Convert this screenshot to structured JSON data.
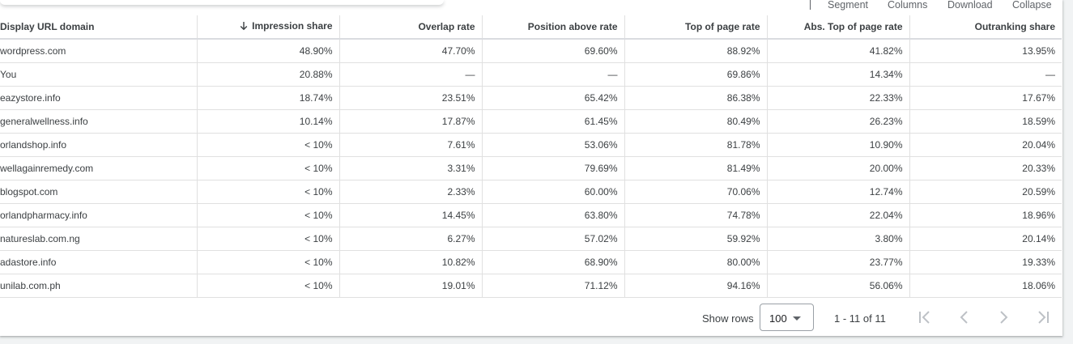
{
  "toolbar": {
    "segment_label": "Segment",
    "columns_label": "Columns",
    "download_label": "Download",
    "collapse_label": "Collapse"
  },
  "table": {
    "headers": [
      "Display URL domain",
      "Impression share",
      "Overlap rate",
      "Position above rate",
      "Top of page rate",
      "Abs. Top of page rate",
      "Outranking share"
    ],
    "sort_icon": "arrow-downward-icon",
    "rows": [
      [
        "wordpress.com",
        "48.90%",
        "47.70%",
        "69.60%",
        "88.92%",
        "41.82%",
        "13.95%"
      ],
      [
        "You",
        "20.88%",
        "—",
        "—",
        "69.86%",
        "14.34%",
        "—"
      ],
      [
        "eazystore.info",
        "18.74%",
        "23.51%",
        "65.42%",
        "86.38%",
        "22.33%",
        "17.67%"
      ],
      [
        "generalwellness.info",
        "10.14%",
        "17.87%",
        "61.45%",
        "80.49%",
        "26.23%",
        "18.59%"
      ],
      [
        "orlandshop.info",
        "< 10%",
        "7.61%",
        "53.06%",
        "81.78%",
        "10.90%",
        "20.04%"
      ],
      [
        "wellagainremedy.com",
        "< 10%",
        "3.31%",
        "79.69%",
        "81.49%",
        "20.00%",
        "20.33%"
      ],
      [
        "blogspot.com",
        "< 10%",
        "2.33%",
        "60.00%",
        "70.06%",
        "12.74%",
        "20.59%"
      ],
      [
        "orlandpharmacy.info",
        "< 10%",
        "14.45%",
        "63.80%",
        "74.78%",
        "22.04%",
        "18.96%"
      ],
      [
        "natureslab.com.ng",
        "< 10%",
        "6.27%",
        "57.02%",
        "59.92%",
        "3.80%",
        "20.14%"
      ],
      [
        "adastore.info",
        "< 10%",
        "10.82%",
        "68.90%",
        "80.00%",
        "23.77%",
        "19.33%"
      ],
      [
        "unilab.com.ph",
        "< 10%",
        "19.01%",
        "71.12%",
        "94.16%",
        "56.06%",
        "18.06%"
      ]
    ]
  },
  "pagination": {
    "show_rows_label": "Show rows",
    "rows_value": "100",
    "range_text": "1 - 11 of 11",
    "first_icon": "first-page-icon",
    "prev_icon": "chevron-left-icon",
    "next_icon": "chevron-right-icon",
    "last_icon": "last-page-icon"
  },
  "colors": {
    "text": "#3c4043",
    "muted": "#5f6368",
    "border": "#e0e0e0",
    "nav_disabled": "#bdc1c6"
  }
}
